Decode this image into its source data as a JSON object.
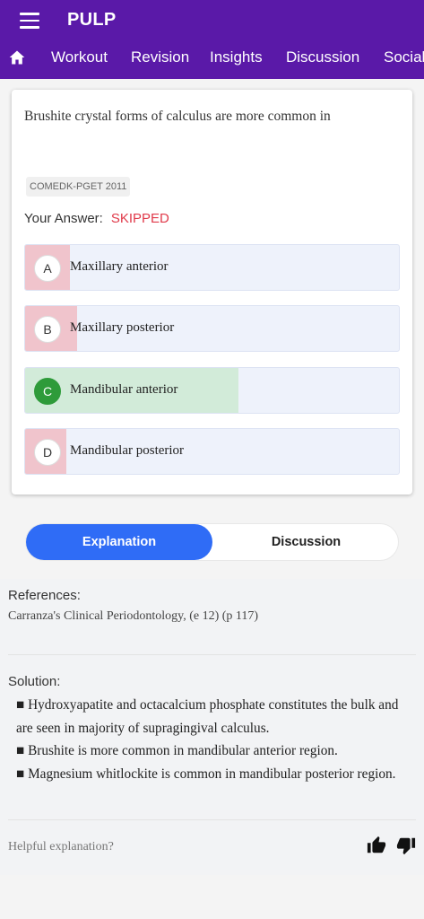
{
  "app": {
    "title": "PULP"
  },
  "nav": {
    "items": [
      "Workout",
      "Revision",
      "Insights",
      "Discussion",
      "Social"
    ]
  },
  "question": {
    "text": "Brushite crystal forms of calculus are more common in",
    "tag": "COMEDK-PGET 2011",
    "answer_label": "Your Answer:",
    "answer_value": "SKIPPED",
    "options": [
      {
        "letter": "A",
        "text": "Maxillary anterior",
        "percent": 12,
        "correct": false
      },
      {
        "letter": "B",
        "text": "Maxillary posterior",
        "percent": 14,
        "correct": false
      },
      {
        "letter": "C",
        "text": "Mandibular anterior",
        "percent": 57,
        "correct": true
      },
      {
        "letter": "D",
        "text": "Mandibular posterior",
        "percent": 11,
        "correct": false
      }
    ]
  },
  "tabs": {
    "explanation": "Explanation",
    "discussion": "Discussion"
  },
  "references": {
    "heading": "References:",
    "text": "Carranza's Clinical Periodontology, (e 12) (p 117)"
  },
  "solution": {
    "heading": "Solution:",
    "points": [
      "■ Hydroxyapatite and octacalcium phosphate constitutes the bulk and are seen in majority of supragingival calculus.",
      "■ Brushite is more common in mandibular anterior region.",
      "■ Magnesium whitlockite is common in mandibular posterior region."
    ]
  },
  "feedback": {
    "prompt": "Helpful explanation?"
  },
  "colors": {
    "brand": "#5a19a8",
    "wrong_fill": "#f0c4cc",
    "correct_fill": "#d2ebd9",
    "active_tab": "#2f6cf6",
    "skipped": "#e03a4a"
  }
}
